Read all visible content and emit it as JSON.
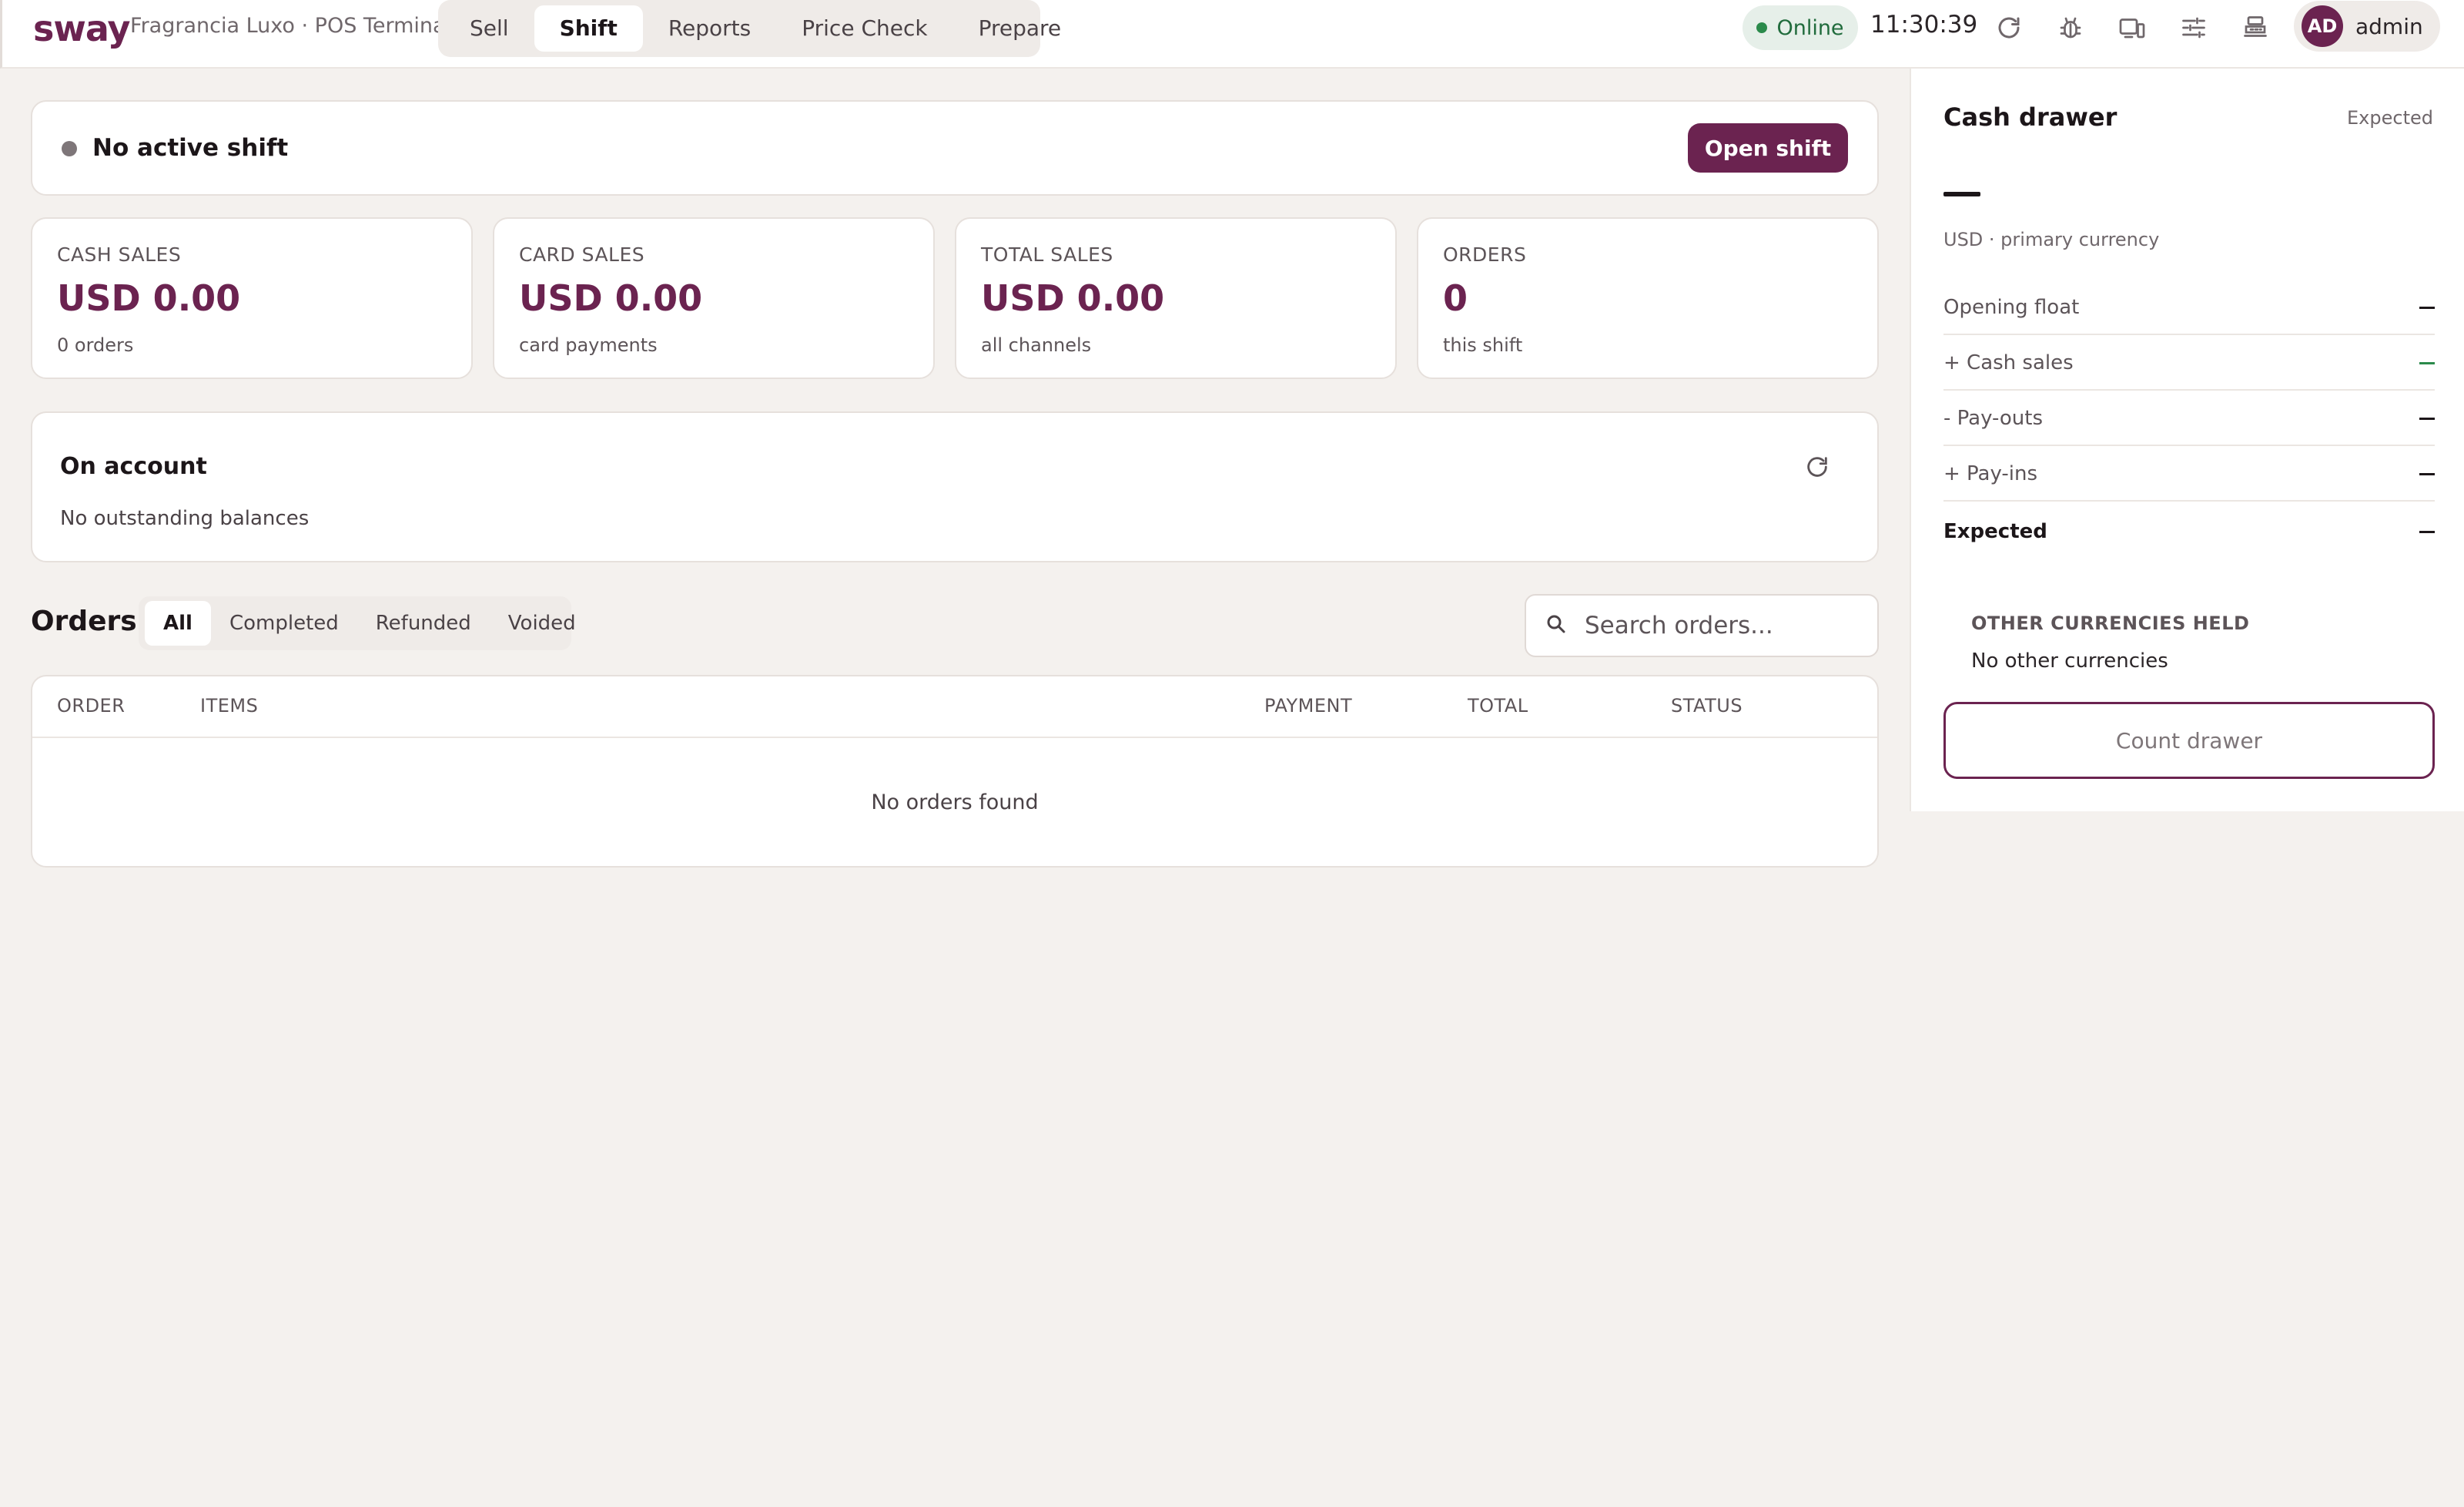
{
  "brand": {
    "logo": "sway",
    "store": "Fragrancia Luxo · POS Terminal",
    "accent": "#6b2350"
  },
  "nav": {
    "tabs": [
      {
        "label": "Sell"
      },
      {
        "label": "Shift",
        "active": true
      },
      {
        "label": "Reports"
      },
      {
        "label": "Price Check"
      },
      {
        "label": "Prepare"
      }
    ]
  },
  "status": {
    "label": "Online",
    "color": "#2b8a4b"
  },
  "clock": "11:30:39",
  "toolbar_icons": [
    "refresh-icon",
    "bug-icon",
    "display-icon",
    "sliders-icon",
    "cash-register-icon"
  ],
  "user": {
    "initials": "AD",
    "name": "admin"
  },
  "shift": {
    "status": "No active shift",
    "open_button": "Open shift"
  },
  "stats": [
    {
      "label": "CASH SALES",
      "value": "USD 0.00",
      "sub": "0 orders"
    },
    {
      "label": "CARD SALES",
      "value": "USD 0.00",
      "sub": "card payments"
    },
    {
      "label": "TOTAL SALES",
      "value": "USD 0.00",
      "sub": "all channels"
    },
    {
      "label": "ORDERS",
      "value": "0",
      "sub": "this shift"
    }
  ],
  "account": {
    "title": "On account",
    "sub": "No outstanding balances"
  },
  "orders": {
    "title": "Orders",
    "filters": [
      {
        "label": "All",
        "active": true
      },
      {
        "label": "Completed"
      },
      {
        "label": "Refunded"
      },
      {
        "label": "Voided"
      }
    ],
    "search_placeholder": "Search orders...",
    "columns": [
      "ORDER",
      "ITEMS",
      "PAYMENT",
      "TOTAL",
      "STATUS"
    ],
    "rows": [],
    "empty": "No orders found"
  },
  "drawer": {
    "title": "Cash drawer",
    "expected_label": "Expected",
    "currency": "USD · primary currency",
    "rows": [
      {
        "label": "Opening float"
      },
      {
        "label": "+ Cash sales"
      },
      {
        "label": "- Pay-outs"
      },
      {
        "label": "+ Pay-ins"
      },
      {
        "label": "Expected"
      }
    ],
    "other_title": "OTHER CURRENCIES HELD",
    "other_sub": "No other currencies",
    "count_button": "Count drawer"
  }
}
